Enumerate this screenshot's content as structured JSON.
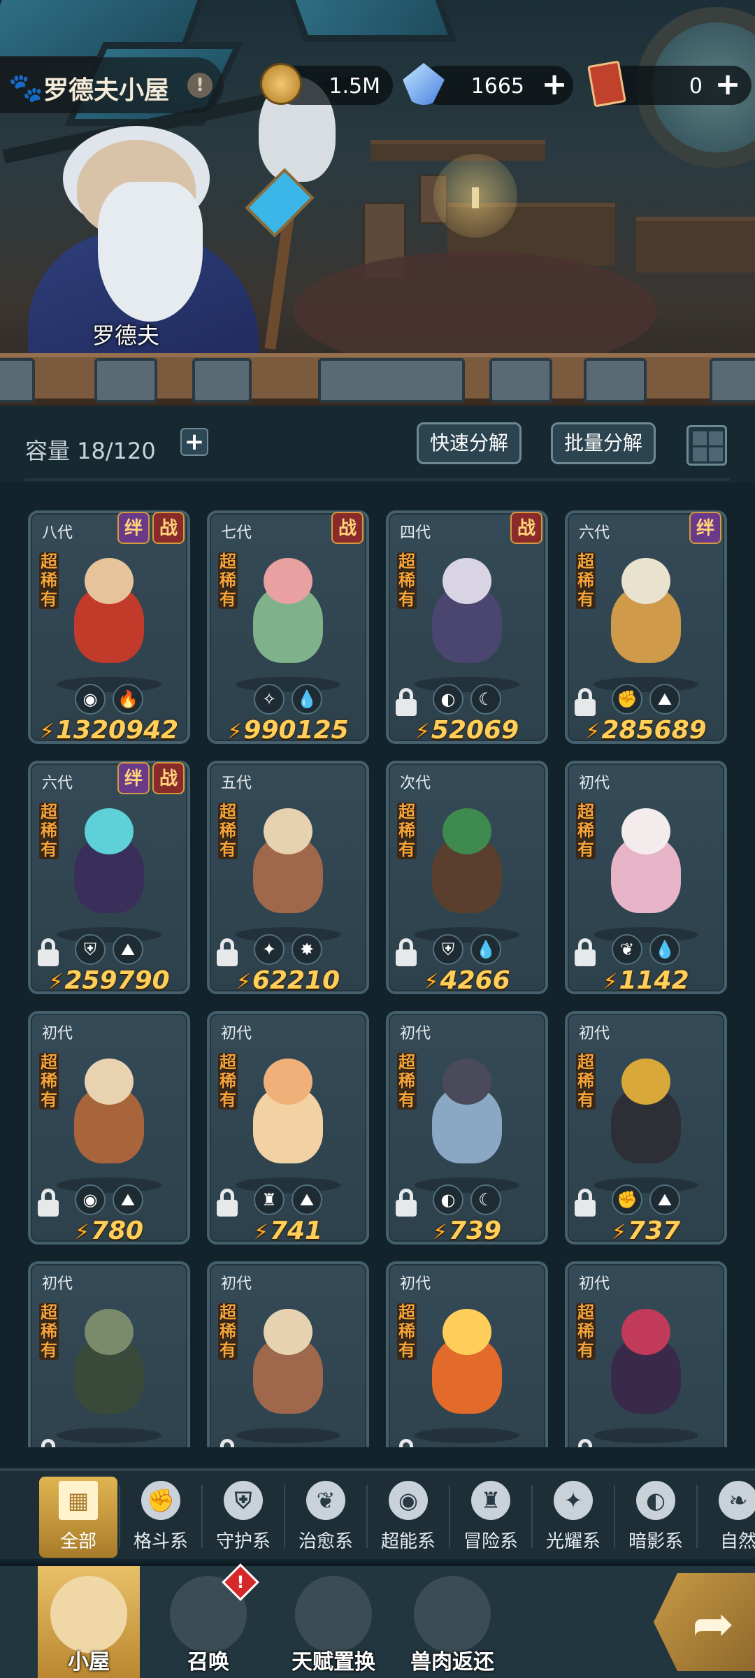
{
  "scene": {
    "npc_name": "罗德夫"
  },
  "topbar": {
    "house_title": "罗德夫小屋",
    "info_glyph": "!",
    "resources": [
      {
        "name": "gold-coin-icon",
        "value": "1.5M"
      },
      {
        "name": "crystal-icon",
        "value": "1665",
        "plus": "+"
      },
      {
        "name": "ticket-icon",
        "value": "0",
        "plus": "+"
      }
    ]
  },
  "inventory": {
    "capacity_label": "容量 18/120",
    "add_glyph": "+",
    "quick_decompose": "快速分解",
    "batch_decompose": "批量分解"
  },
  "labels": {
    "bond": "绊",
    "war": "战",
    "rarity": "超稀有"
  },
  "cards": [
    {
      "gen": "八代",
      "bond": true,
      "war": true,
      "locked": false,
      "elements": [
        "psychic-element-icon",
        "fire-element-icon"
      ],
      "element_glyphs": [
        "◉",
        "🔥"
      ],
      "power": "1320942",
      "colors": [
        "#c23a2a",
        "#e6c39a"
      ]
    },
    {
      "gen": "七代",
      "bond": false,
      "war": true,
      "locked": false,
      "elements": [
        "light-element-icon",
        "water-element-icon"
      ],
      "element_glyphs": [
        "✧",
        "💧"
      ],
      "power": "990125",
      "colors": [
        "#7fb28a",
        "#e8a0a0"
      ]
    },
    {
      "gen": "四代",
      "bond": false,
      "war": true,
      "locked": true,
      "elements": [
        "shadow-element-icon",
        "dark-moon-element-icon"
      ],
      "element_glyphs": [
        "◐",
        "☾"
      ],
      "power": "52069",
      "colors": [
        "#4a4670",
        "#d8d4e4"
      ]
    },
    {
      "gen": "六代",
      "bond": true,
      "war": false,
      "locked": true,
      "elements": [
        "fist-element-icon",
        "earth-element-icon"
      ],
      "element_glyphs": [
        "✊",
        "⛰"
      ],
      "power": "285689",
      "colors": [
        "#cf9a4a",
        "#e9e2cf"
      ]
    },
    {
      "gen": "六代",
      "bond": true,
      "war": true,
      "locked": true,
      "elements": [
        "guard-element-icon",
        "earth-element-icon"
      ],
      "element_glyphs": [
        "⛨",
        "⛰"
      ],
      "power": "259790",
      "colors": [
        "#3a2f5a",
        "#5ed0d8"
      ]
    },
    {
      "gen": "五代",
      "bond": false,
      "war": false,
      "locked": true,
      "elements": [
        "radiance-element-icon",
        "sun-element-icon"
      ],
      "element_glyphs": [
        "✦",
        "✸"
      ],
      "power": "62210",
      "colors": [
        "#a0684a",
        "#e6d2b0"
      ]
    },
    {
      "gen": "次代",
      "bond": false,
      "war": false,
      "locked": true,
      "elements": [
        "guard-element-icon",
        "water-element-icon"
      ],
      "element_glyphs": [
        "⛨",
        "💧"
      ],
      "power": "4266",
      "colors": [
        "#5a3e2e",
        "#3f8a4e"
      ]
    },
    {
      "gen": "初代",
      "bond": false,
      "war": false,
      "locked": true,
      "elements": [
        "heal-element-icon",
        "water-element-icon"
      ],
      "element_glyphs": [
        "❦",
        "💧"
      ],
      "power": "1142",
      "colors": [
        "#e8b5c8",
        "#f4ecec"
      ]
    },
    {
      "gen": "初代",
      "bond": false,
      "war": false,
      "locked": true,
      "elements": [
        "psychic-element-icon",
        "earth-element-icon"
      ],
      "element_glyphs": [
        "◉",
        "⛰"
      ],
      "power": "780",
      "colors": [
        "#a8643a",
        "#e8d2b0"
      ]
    },
    {
      "gen": "初代",
      "bond": false,
      "war": false,
      "locked": true,
      "elements": [
        "adventure-element-icon",
        "earth-element-icon"
      ],
      "element_glyphs": [
        "♜",
        "⛰"
      ],
      "power": "741",
      "colors": [
        "#f2d2a2",
        "#f0b07a"
      ]
    },
    {
      "gen": "初代",
      "bond": false,
      "war": false,
      "locked": true,
      "elements": [
        "shadow-element-icon",
        "dark-moon-element-icon"
      ],
      "element_glyphs": [
        "◐",
        "☾"
      ],
      "power": "739",
      "colors": [
        "#8aa8c4",
        "#4a4a5a"
      ]
    },
    {
      "gen": "初代",
      "bond": false,
      "war": false,
      "locked": true,
      "elements": [
        "fist-element-icon",
        "earth-element-icon"
      ],
      "element_glyphs": [
        "✊",
        "⛰"
      ],
      "power": "737",
      "colors": [
        "#2e2f36",
        "#d8a83a"
      ]
    },
    {
      "gen": "初代",
      "bond": false,
      "war": false,
      "locked": true,
      "elements": [],
      "element_glyphs": [],
      "power": "",
      "colors": [
        "#3a4a3a",
        "#7a8a6a"
      ]
    },
    {
      "gen": "初代",
      "bond": false,
      "war": false,
      "locked": true,
      "elements": [],
      "element_glyphs": [],
      "power": "",
      "colors": [
        "#a0684a",
        "#e6d2b0"
      ]
    },
    {
      "gen": "初代",
      "bond": false,
      "war": false,
      "locked": true,
      "elements": [],
      "element_glyphs": [],
      "power": "",
      "colors": [
        "#e26a2a",
        "#ffce5a"
      ]
    },
    {
      "gen": "初代",
      "bond": false,
      "war": false,
      "locked": true,
      "elements": [],
      "element_glyphs": [],
      "power": "",
      "colors": [
        "#3a2a4a",
        "#c23a5a"
      ]
    }
  ],
  "categories": [
    {
      "label": "全部",
      "icon": "all-blocks-icon",
      "glyph": "▦",
      "active": true
    },
    {
      "label": "格斗系",
      "icon": "fist-icon",
      "glyph": "✊",
      "active": false
    },
    {
      "label": "守护系",
      "icon": "shield-icon",
      "glyph": "⛨",
      "active": false
    },
    {
      "label": "治愈系",
      "icon": "sprout-icon",
      "glyph": "❦",
      "active": false
    },
    {
      "label": "超能系",
      "icon": "alien-icon",
      "glyph": "◉",
      "active": false
    },
    {
      "label": "冒险系",
      "icon": "lantern-icon",
      "glyph": "♜",
      "active": false
    },
    {
      "label": "光耀系",
      "icon": "radiance-icon",
      "glyph": "✦",
      "active": false
    },
    {
      "label": "暗影系",
      "icon": "eye-icon",
      "glyph": "◐",
      "active": false
    },
    {
      "label": "自然",
      "icon": "leaf-icon",
      "glyph": "❧",
      "active": false
    }
  ],
  "bottom_nav": [
    {
      "label": "小屋",
      "icon": "house-icon",
      "active": true
    },
    {
      "label": "召唤",
      "icon": "egg-icon",
      "active": false,
      "alert": "!"
    },
    {
      "label": "天赋置换",
      "icon": "swap-icon",
      "active": false
    },
    {
      "label": "兽肉返还",
      "icon": "meat-icon",
      "active": false
    }
  ],
  "share_glyph": "➦",
  "colors": {
    "power_text": "#ffcf5a",
    "rarity_text": "#f6a43a",
    "active_gold": "#e0b550",
    "card_bg": "#2d414c"
  }
}
